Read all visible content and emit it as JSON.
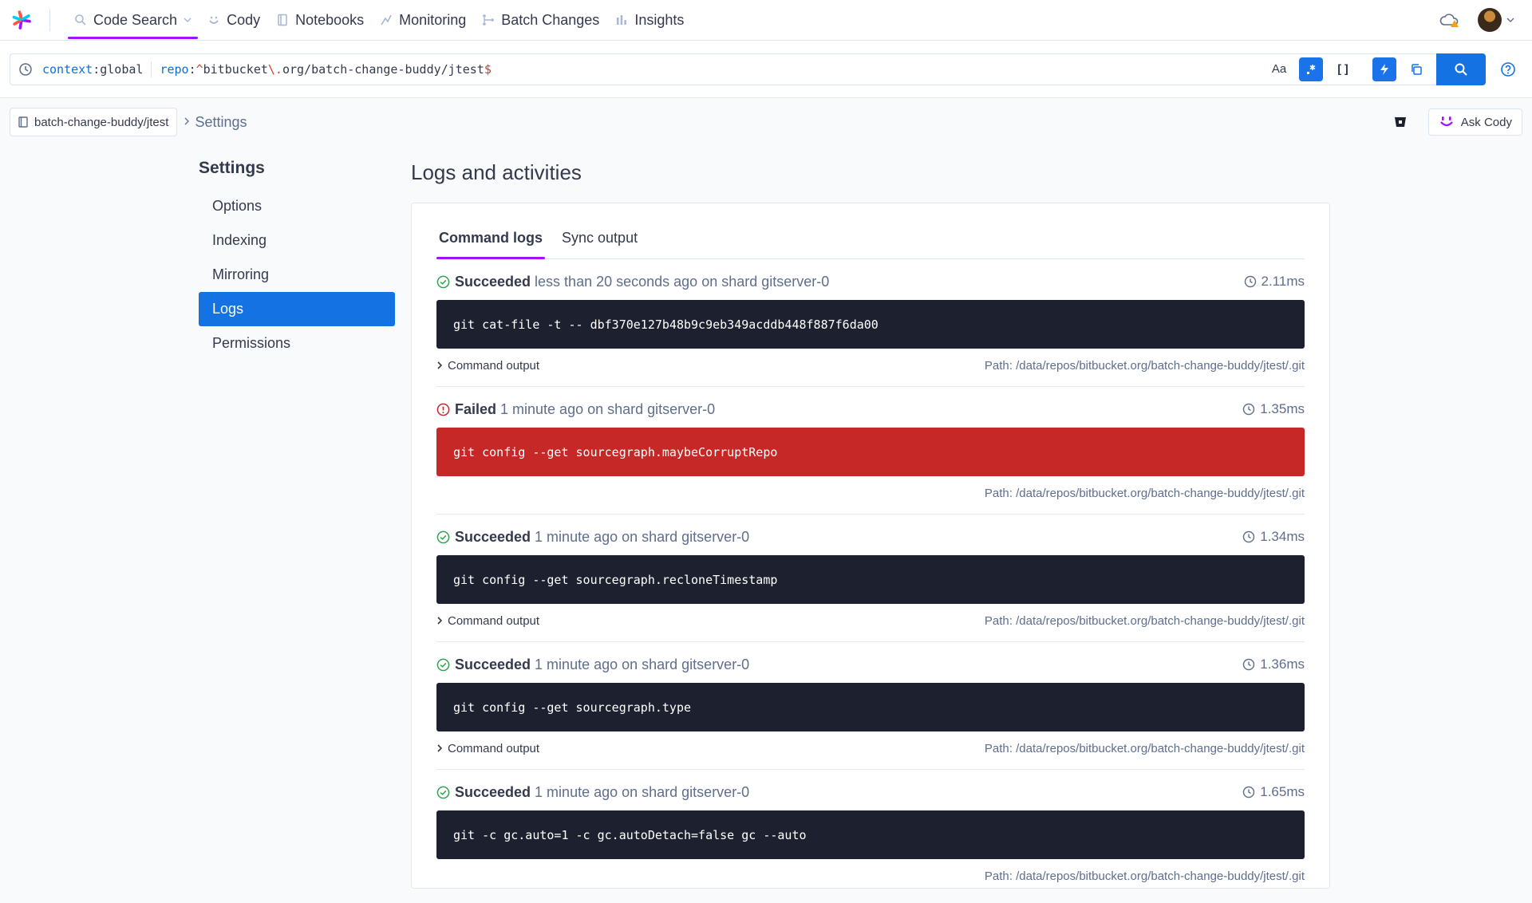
{
  "nav": {
    "items": [
      {
        "label": "Code Search",
        "icon": "search-icon",
        "active": true
      },
      {
        "label": "Cody",
        "icon": "cody-icon",
        "active": false
      },
      {
        "label": "Notebooks",
        "icon": "notebook-icon",
        "active": false
      },
      {
        "label": "Monitoring",
        "icon": "monitoring-icon",
        "active": false
      },
      {
        "label": "Batch Changes",
        "icon": "batch-changes-icon",
        "active": false
      },
      {
        "label": "Insights",
        "icon": "insights-icon",
        "active": false
      }
    ]
  },
  "search": {
    "context_key": "context",
    "context_value": "global",
    "repo_key": "repo",
    "repo_prefix": "^",
    "repo_part1": "bitbucket",
    "repo_escape": "\\.",
    "repo_part2": "org/batch-change-buddy/jtest",
    "repo_suffix": "$",
    "case_toggle": "Aa",
    "structural_toggle": "[]"
  },
  "breadcrumb": {
    "repo": "batch-change-buddy/jtest",
    "current": "Settings"
  },
  "ask_cody": "Ask Cody",
  "sidebar": {
    "title": "Settings",
    "items": [
      {
        "label": "Options",
        "active": false
      },
      {
        "label": "Indexing",
        "active": false
      },
      {
        "label": "Mirroring",
        "active": false
      },
      {
        "label": "Logs",
        "active": true
      },
      {
        "label": "Permissions",
        "active": false
      }
    ]
  },
  "main": {
    "title": "Logs and activities",
    "tabs": [
      {
        "label": "Command logs",
        "active": true
      },
      {
        "label": "Sync output",
        "active": false
      }
    ],
    "entries": [
      {
        "status": "Succeeded",
        "when": "less than 20 seconds ago on shard gitserver-0",
        "duration": "2.11ms",
        "command": "git cat-file -t -- dbf370e127b48b9c9eb349acddb448f887f6da00",
        "failed": false,
        "output_label": "Command output",
        "path": "Path: /data/repos/bitbucket.org/batch-change-buddy/jtest/.git"
      },
      {
        "status": "Failed",
        "when": "1 minute ago on shard gitserver-0",
        "duration": "1.35ms",
        "command": "git config --get sourcegraph.maybeCorruptRepo",
        "failed": true,
        "output_label": "",
        "path": "Path: /data/repos/bitbucket.org/batch-change-buddy/jtest/.git"
      },
      {
        "status": "Succeeded",
        "when": "1 minute ago on shard gitserver-0",
        "duration": "1.34ms",
        "command": "git config --get sourcegraph.recloneTimestamp",
        "failed": false,
        "output_label": "Command output",
        "path": "Path: /data/repos/bitbucket.org/batch-change-buddy/jtest/.git"
      },
      {
        "status": "Succeeded",
        "when": "1 minute ago on shard gitserver-0",
        "duration": "1.36ms",
        "command": "git config --get sourcegraph.type",
        "failed": false,
        "output_label": "Command output",
        "path": "Path: /data/repos/bitbucket.org/batch-change-buddy/jtest/.git"
      },
      {
        "status": "Succeeded",
        "when": "1 minute ago on shard gitserver-0",
        "duration": "1.65ms",
        "command": "git -c gc.auto=1 -c gc.autoDetach=false gc --auto",
        "failed": false,
        "output_label": "",
        "path": "Path: /data/repos/bitbucket.org/batch-change-buddy/jtest/.git"
      }
    ]
  },
  "colors": {
    "accent": "#a112ff",
    "primary": "#1472e3",
    "success": "#2ea44f",
    "danger": "#c62828",
    "terminal": "#1d212f"
  }
}
